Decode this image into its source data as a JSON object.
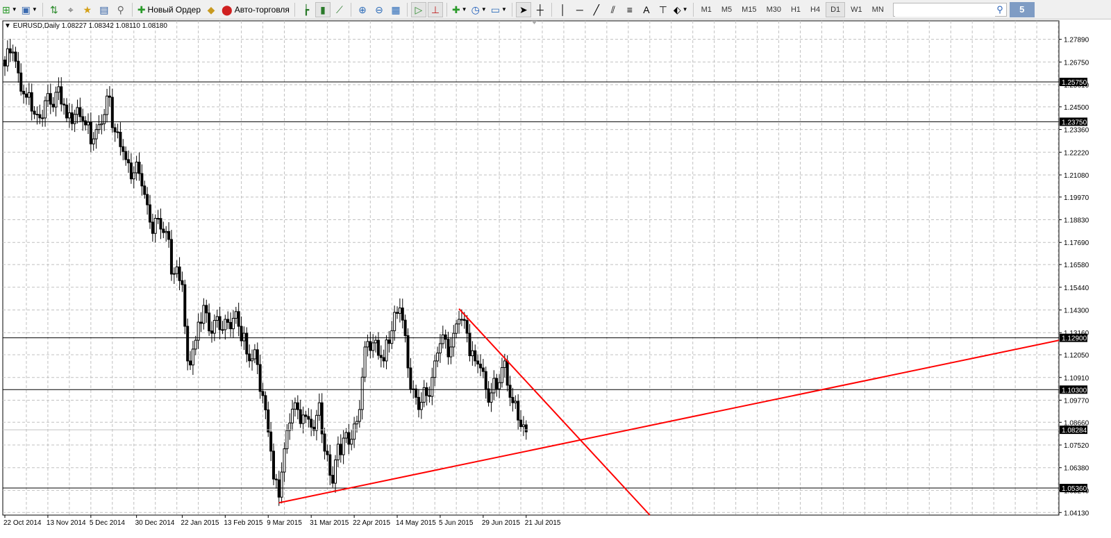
{
  "toolbar": {
    "new_order_label": "Новый Ордер",
    "autotrading_label": "Авто-торговля",
    "icons": [
      "new-chart-icon",
      "profiles-icon",
      "market-watch-icon",
      "crosshair-navigator-icon",
      "favorites-icon",
      "terminal-icon",
      "strategy-tester-icon",
      "new-order-icon",
      "metaeditor-icon",
      "autotrading-icon",
      "bar-chart-icon",
      "candlestick-icon",
      "line-chart-icon",
      "zoom-in-icon",
      "zoom-out-icon",
      "tile-windows-icon",
      "auto-scroll-icon",
      "chart-shift-icon",
      "indicators-icon",
      "periods-icon",
      "templates-icon",
      "cursor-icon",
      "crosshair-icon",
      "vertical-line-icon",
      "horizontal-line-icon",
      "trendline-icon",
      "equidistant-channel-icon",
      "fibonacci-icon",
      "text-icon",
      "text-label-icon",
      "arrows-icon"
    ],
    "timeframes": [
      "M1",
      "M5",
      "M15",
      "M30",
      "H1",
      "H4",
      "D1",
      "W1",
      "MN"
    ],
    "active_timeframe": "D1",
    "search_value": "",
    "chat_badge": "5"
  },
  "chart_header": {
    "symbol": "EURUSD,Daily",
    "ohlc": "1.08227 1.08342 1.08110 1.08180"
  },
  "chart_data": {
    "type": "candlestick",
    "symbol": "EURUSD",
    "timeframe": "Daily",
    "grid": true,
    "price_ticks": [
      "1.27890",
      "1.26750",
      "1.25610",
      "1.24500",
      "1.23360",
      "1.22220",
      "1.21080",
      "1.19970",
      "1.18830",
      "1.17690",
      "1.16580",
      "1.15440",
      "1.14300",
      "1.13160",
      "1.12050",
      "1.10910",
      "1.09770",
      "1.08660",
      "1.07520",
      "1.06380",
      "1.05240",
      "1.04130"
    ],
    "date_labels": [
      {
        "date": "2014-10-22",
        "label": "22 Oct 2014"
      },
      {
        "date": "2014-11-13",
        "label": "13 Nov 2014"
      },
      {
        "date": "2014-12-05",
        "label": "5 Dec 2014"
      },
      {
        "date": "2014-12-30",
        "label": "30 Dec 2014"
      },
      {
        "date": "2015-01-22",
        "label": "22 Jan 2015"
      },
      {
        "date": "2015-02-13",
        "label": "13 Feb 2015"
      },
      {
        "date": "2015-03-09",
        "label": "9 Mar 2015"
      },
      {
        "date": "2015-03-31",
        "label": "31 Mar 2015"
      },
      {
        "date": "2015-04-22",
        "label": "22 Apr 2015"
      },
      {
        "date": "2015-05-14",
        "label": "14 May 2015"
      },
      {
        "date": "2015-06-05",
        "label": "5 Jun 2015"
      },
      {
        "date": "2015-06-29",
        "label": "29 Jun 2015"
      },
      {
        "date": "2015-07-21",
        "label": "21 Jul 2015"
      }
    ],
    "approx_closes": [
      {
        "date": "2014-10-22",
        "close": 1.2655
      },
      {
        "date": "2014-10-27",
        "close": 1.2725
      },
      {
        "date": "2014-10-29",
        "close": 1.262
      },
      {
        "date": "2014-11-03",
        "close": 1.2498
      },
      {
        "date": "2014-11-07",
        "close": 1.2411
      },
      {
        "date": "2014-11-14",
        "close": 1.2463
      },
      {
        "date": "2014-11-19",
        "close": 1.2551
      },
      {
        "date": "2014-11-24",
        "close": 1.2394
      },
      {
        "date": "2014-11-28",
        "close": 1.2446
      },
      {
        "date": "2014-12-03",
        "close": 1.2359
      },
      {
        "date": "2014-12-08",
        "close": 1.2289
      },
      {
        "date": "2014-12-12",
        "close": 1.2411
      },
      {
        "date": "2014-12-16",
        "close": 1.2498
      },
      {
        "date": "2014-12-18",
        "close": 1.2324
      },
      {
        "date": "2014-12-24",
        "close": 1.2185
      },
      {
        "date": "2014-12-31",
        "close": 1.2115
      },
      {
        "date": "2015-01-02",
        "close": 1.201
      },
      {
        "date": "2015-01-06",
        "close": 1.1871
      },
      {
        "date": "2015-01-12",
        "close": 1.1836
      },
      {
        "date": "2015-01-15",
        "close": 1.1784
      },
      {
        "date": "2015-01-16",
        "close": 1.161
      },
      {
        "date": "2015-01-22",
        "close": 1.1557
      },
      {
        "date": "2015-01-23",
        "close": 1.1348
      },
      {
        "date": "2015-01-26",
        "close": 1.1174
      },
      {
        "date": "2015-01-29",
        "close": 1.1278
      },
      {
        "date": "2015-02-03",
        "close": 1.1453
      },
      {
        "date": "2015-02-06",
        "close": 1.1313
      },
      {
        "date": "2015-02-13",
        "close": 1.1383
      },
      {
        "date": "2015-02-20",
        "close": 1.1348
      },
      {
        "date": "2015-02-24",
        "close": 1.1313
      },
      {
        "date": "2015-02-25",
        "close": 1.1209
      },
      {
        "date": "2015-03-03",
        "close": 1.1156
      },
      {
        "date": "2015-03-05",
        "close": 1.1
      },
      {
        "date": "2015-03-10",
        "close": 1.0721
      },
      {
        "date": "2015-03-11",
        "close": 1.0581
      },
      {
        "date": "2015-03-13",
        "close": 1.049
      },
      {
        "date": "2015-03-16",
        "close": 1.0616
      },
      {
        "date": "2015-03-18",
        "close": 1.0825
      },
      {
        "date": "2015-03-23",
        "close": 1.0964
      },
      {
        "date": "2015-03-27",
        "close": 1.0895
      },
      {
        "date": "2015-04-01",
        "close": 1.0825
      },
      {
        "date": "2015-04-03",
        "close": 1.0964
      },
      {
        "date": "2015-04-07",
        "close": 1.0721
      },
      {
        "date": "2015-04-10",
        "close": 1.056
      },
      {
        "date": "2015-04-14",
        "close": 1.0756
      },
      {
        "date": "2015-04-20",
        "close": 1.0756
      },
      {
        "date": "2015-04-24",
        "close": 1.093
      },
      {
        "date": "2015-04-28",
        "close": 1.1244
      },
      {
        "date": "2015-05-04",
        "close": 1.1278
      },
      {
        "date": "2015-05-07",
        "close": 1.1174
      },
      {
        "date": "2015-05-13",
        "close": 1.1418
      },
      {
        "date": "2015-05-15",
        "close": 1.144
      },
      {
        "date": "2015-05-20",
        "close": 1.1139
      },
      {
        "date": "2015-05-26",
        "close": 1.093
      },
      {
        "date": "2015-05-29",
        "close": 1.1
      },
      {
        "date": "2015-06-03",
        "close": 1.1174
      },
      {
        "date": "2015-06-05",
        "close": 1.1261
      },
      {
        "date": "2015-06-11",
        "close": 1.1244
      },
      {
        "date": "2015-06-16",
        "close": 1.1383
      },
      {
        "date": "2015-06-19",
        "close": 1.1313
      },
      {
        "date": "2015-06-24",
        "close": 1.1174
      },
      {
        "date": "2015-06-26",
        "close": 1.1139
      },
      {
        "date": "2015-06-30",
        "close": 1.1034
      },
      {
        "date": "2015-07-06",
        "close": 1.1034
      },
      {
        "date": "2015-07-09",
        "close": 1.1174
      },
      {
        "date": "2015-07-14",
        "close": 1.0964
      },
      {
        "date": "2015-07-16",
        "close": 1.0877
      },
      {
        "date": "2015-07-21",
        "close": 1.0818
      }
    ],
    "horizontal_levels": [
      "1.25750",
      "1.23750",
      "1.12900",
      "1.10300",
      "1.05360"
    ],
    "current_price": "1.08284",
    "trendlines": [
      {
        "from": {
          "date": "2015-03-13",
          "price": 1.0462
        },
        "through": {
          "date": "2015-04-13",
          "price": 1.0521
        },
        "color": "#ff0000"
      },
      {
        "from": {
          "date": "2015-06-16",
          "price": 1.1436
        },
        "through": {
          "date": "2015-07-09",
          "price": 1.1188
        },
        "color": "#ff0000"
      }
    ],
    "colors": {
      "bull_fill": "#ffffff",
      "bear_fill": "#000000",
      "candle_outline": "#000000",
      "grid": "#c0c0c0",
      "level_line": "#000000",
      "current_price_line": "#c0c0c0",
      "trendline": "#ff0000"
    }
  }
}
